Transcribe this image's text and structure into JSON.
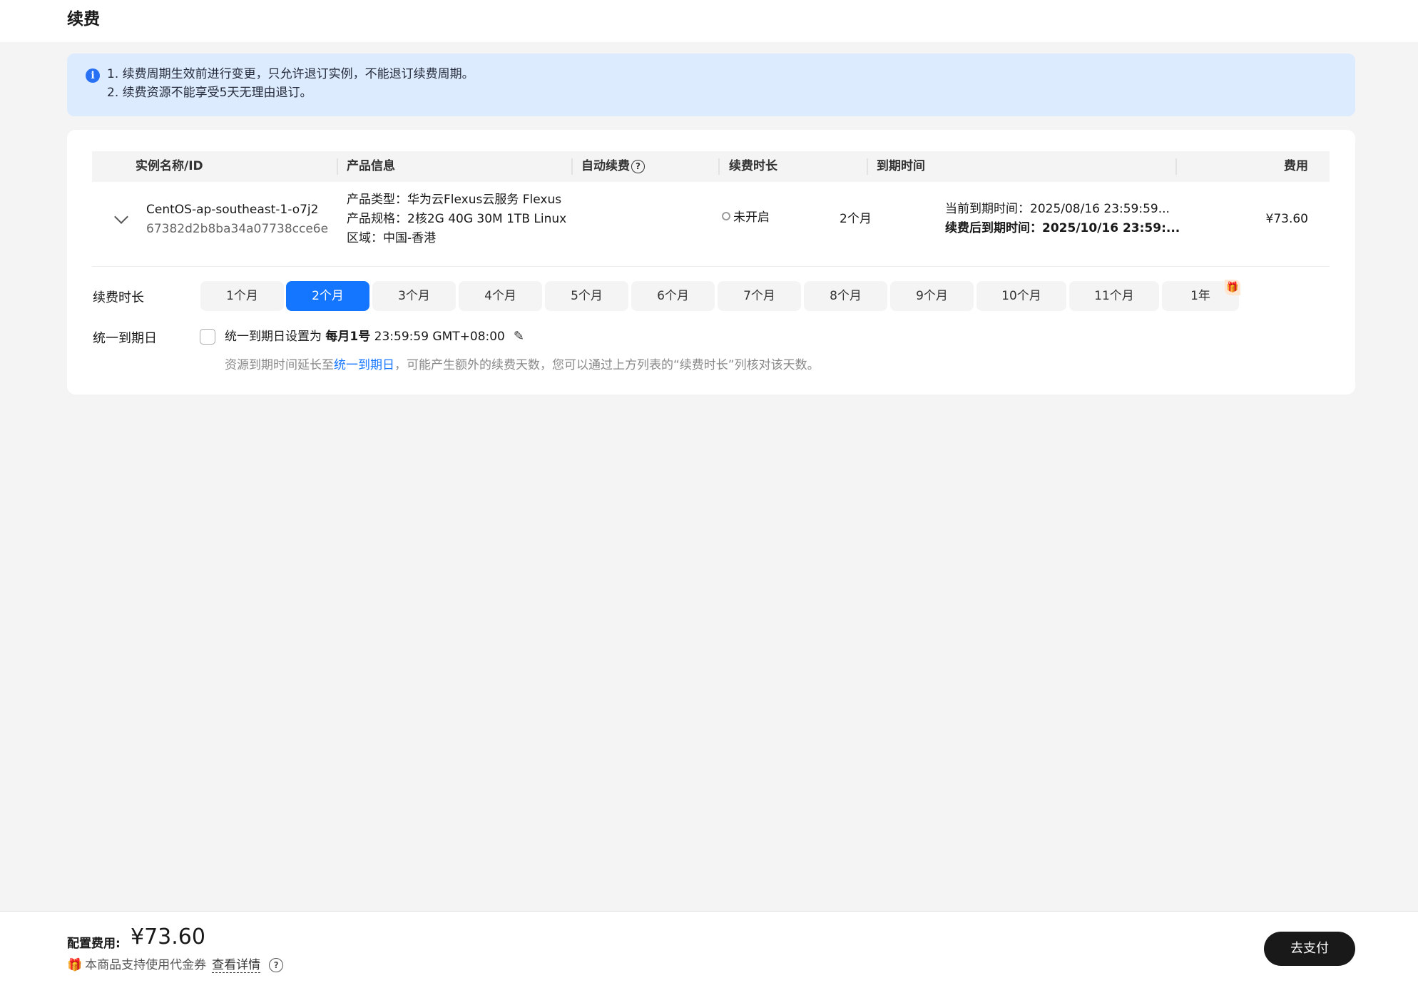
{
  "page": {
    "title": "续费"
  },
  "notice": {
    "lines": [
      "1. 续费周期生效前进行变更，只允许退订实例，不能退订续费周期。",
      "2. 续费资源不能享受5天无理由退订。"
    ]
  },
  "table": {
    "headers": {
      "instance": "实例名称/ID",
      "product": "产品信息",
      "auto_renew": "自动续费",
      "duration": "续费时长",
      "expiry": "到期时间",
      "fee": "费用"
    },
    "row": {
      "instance_name": "CentOS-ap-southeast-1-o7j2",
      "instance_id": "67382d2b8ba34a07738cce6e",
      "product_type": "产品类型：华为云Flexus云服务 Flexus",
      "product_spec": "产品规格：2核2G 40G 30M 1TB Linux",
      "region": "区域：中国-香港",
      "auto_renew_status": "未开启",
      "duration": "2个月",
      "current_expiry": "当前到期时间：2025/08/16 23:59:59...",
      "new_expiry": "续费后到期时间：2025/10/16 23:59:...",
      "fee": "¥73.60"
    }
  },
  "renew_duration": {
    "label": "续费时长",
    "options": [
      "1个月",
      "2个月",
      "3个月",
      "4个月",
      "5个月",
      "6个月",
      "7个月",
      "8个月",
      "9个月",
      "10个月",
      "11个月",
      "1年"
    ],
    "selected": "2个月"
  },
  "unify_date": {
    "label": "统一到期日",
    "text_prefix": "统一到期日设置为 ",
    "day": "每月1号",
    "time": " 23:59:59 GMT+08:00",
    "hint_prefix": "资源到期时间延长至",
    "hint_link": "统一到期日",
    "hint_suffix": "，可能产生额外的续费天数，您可以通过上方列表的“续费时长”列核对该天数。"
  },
  "footer": {
    "fee_label": "配置费用:",
    "fee_value": "¥73.60",
    "coupon_text": "本商品支持使用代金券",
    "detail_link": "查看详情",
    "pay_button": "去支付"
  },
  "colors": {
    "accent": "#1476ff",
    "notice_bg": "#dcebfe",
    "pay_bg": "#191919",
    "gift": "#f07b1a"
  }
}
